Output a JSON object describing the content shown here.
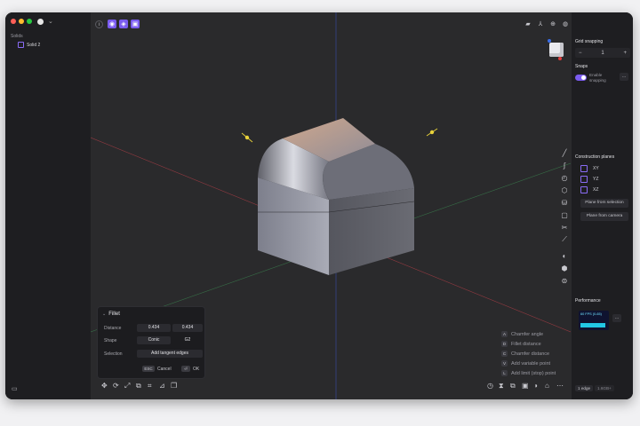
{
  "left_sidebar": {
    "section_title": "Solids",
    "items": [
      {
        "label": "Solid 2"
      }
    ]
  },
  "viewport": {
    "fillet_panel": {
      "title": "Fillet",
      "distance_label": "Distance",
      "distance_values": [
        "0.434",
        "0.434"
      ],
      "shape_label": "Shape",
      "shape_values": [
        "Conic",
        "G2"
      ],
      "selection_label": "Selection",
      "selection_button": "Add tangent edges",
      "esc_key": "ESC",
      "cancel_label": "Cancel",
      "ok_key": "⏎",
      "ok_label": "OK"
    },
    "shortcut_hints": [
      {
        "key": "A",
        "label": "Chamfer angle"
      },
      {
        "key": "D",
        "label": "Fillet distance"
      },
      {
        "key": "C",
        "label": "Chamfer distance"
      },
      {
        "key": "V",
        "label": "Add variable point"
      },
      {
        "key": "L",
        "label": "Add limit (stop) point"
      }
    ]
  },
  "right_sidebar": {
    "grid_snapping_title": "Grid snapping",
    "grid_value": "1",
    "minus": "−",
    "plus": "+",
    "snaps_title": "Snaps",
    "enable_snapping_label": "Enable snapping",
    "more": "…",
    "construction_planes_title": "Construction planes",
    "planes": [
      "XY",
      "YZ",
      "XZ"
    ],
    "plane_from_selection": "Plane from selection",
    "plane_from_camera": "Plane from camera",
    "performance_title": "Performance",
    "fps_label": "60 FPS (0-65)",
    "status_edges": "1 edge",
    "status_extra": "1.6GB+"
  },
  "colors": {
    "accent": "#7b5cf0",
    "viewport_bg": "#2a2a2c",
    "axis_x": "#c0404a",
    "axis_y": "#3a56c8",
    "axis_z": "#3c8a52",
    "fps_bar": "#22c7e6"
  }
}
